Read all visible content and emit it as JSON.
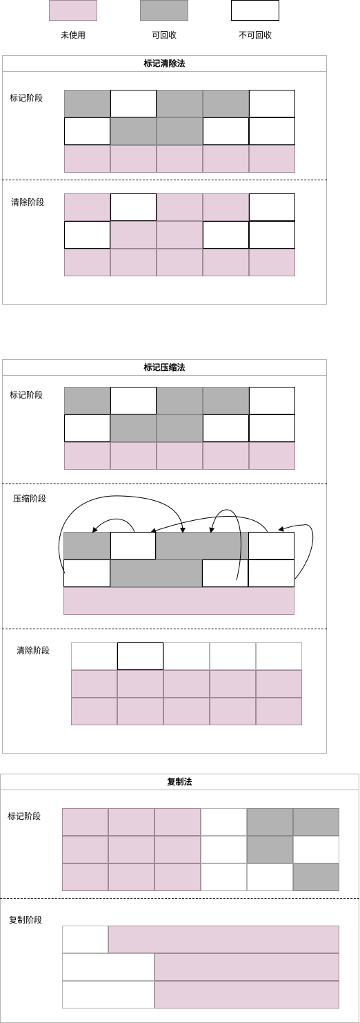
{
  "legend": {
    "unused": "未使用",
    "recyclable": "可回收",
    "non_recyclable": "不可回收"
  },
  "colors": {
    "unused": "#e6d0de",
    "recyclable": "#b3b3b3",
    "non_recyclable": "#ffffff"
  },
  "mark_sweep": {
    "title": "标记清除法",
    "mark_stage": "标记阶段",
    "sweep_stage": "清除阶段"
  },
  "mark_compact": {
    "title": "标记压缩法",
    "mark_stage": "标记阶段",
    "compact_stage": "压缩阶段",
    "sweep_stage": "清除阶段"
  },
  "copying": {
    "title": "复制法",
    "mark_stage": "标记阶段",
    "copy_stage": "复制阶段"
  }
}
